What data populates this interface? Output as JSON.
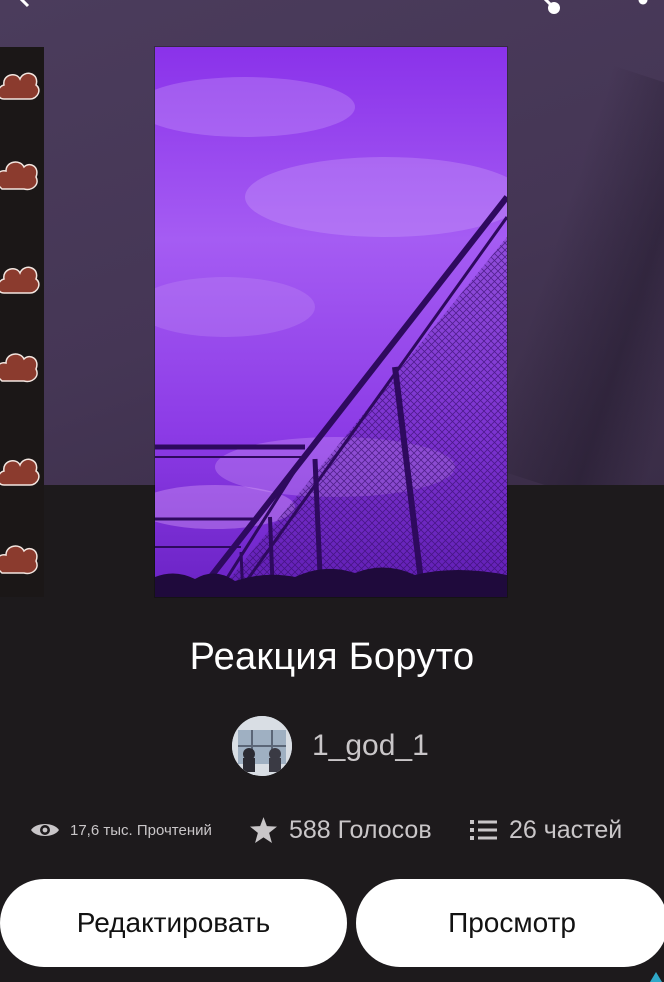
{
  "story": {
    "title": "Реакция Боруто",
    "author": "1_god_1"
  },
  "stats": {
    "reads": "17,6 тыс. Прочтений",
    "votes": "588 Голосов",
    "parts": "26 частей"
  },
  "actions": {
    "edit_label": "Редактировать",
    "view_label": "Просмотр"
  },
  "icons": {
    "back": "back-arrow-icon",
    "share": "share-icon",
    "more": "more-vertical-icon",
    "reads": "eye-icon",
    "votes": "star-icon",
    "parts": "list-icon"
  },
  "colors": {
    "background": "#1d1a1c",
    "hero": "#453655",
    "cover_accent": "#8a3cf0",
    "button": "#ffffff",
    "stat_text": "#c9c6c8"
  }
}
